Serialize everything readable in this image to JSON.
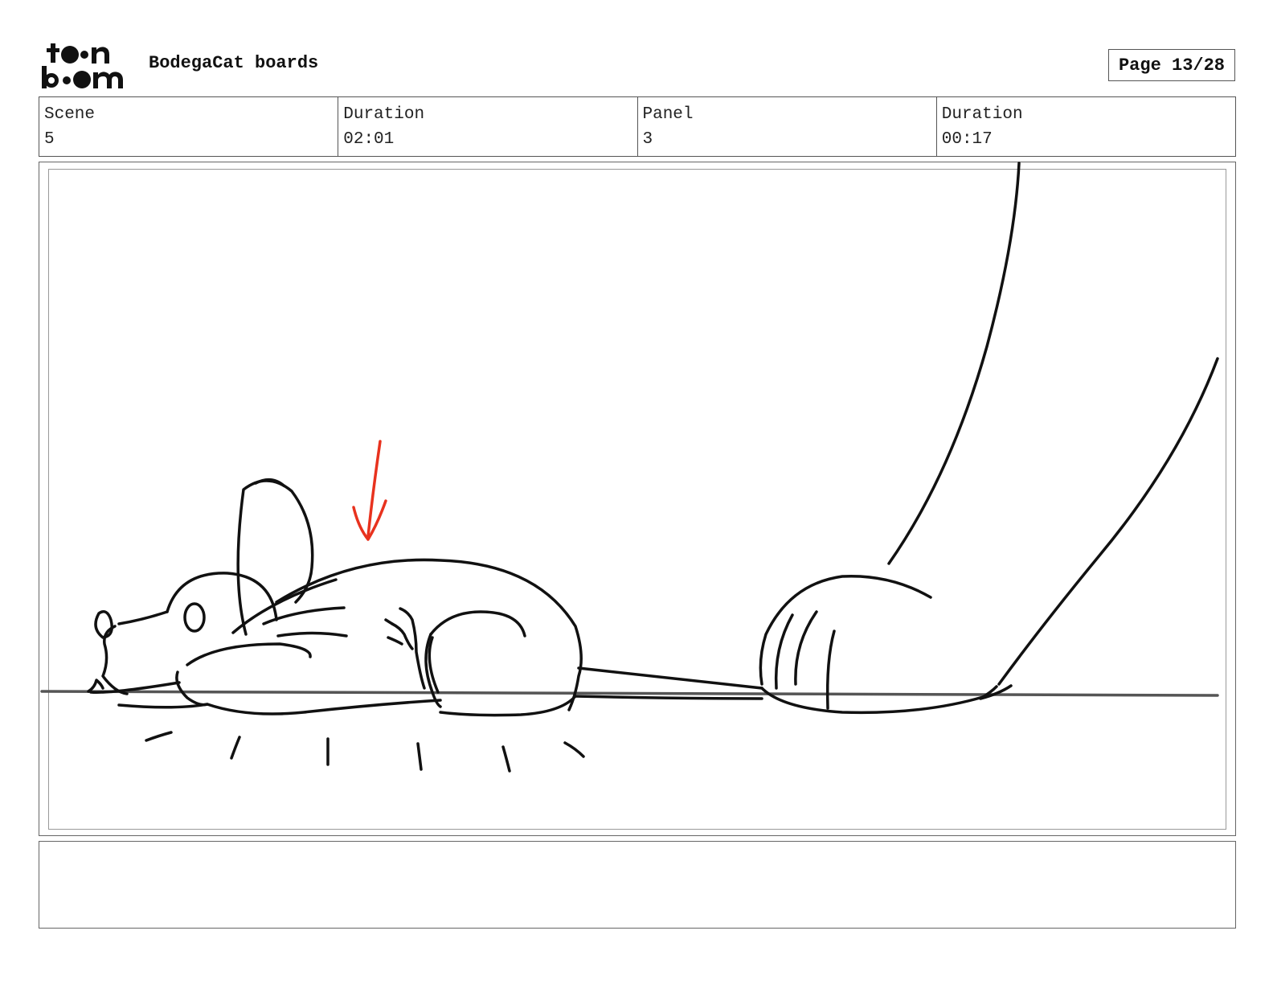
{
  "header": {
    "project_title": "BodegaCat boards",
    "page_label": "Page 13/28"
  },
  "info": {
    "scene_label": "Scene",
    "scene_value": "5",
    "scene_duration_label": "Duration",
    "scene_duration_value": "02:01",
    "panel_label": "Panel",
    "panel_value": "3",
    "panel_duration_label": "Duration",
    "panel_duration_value": "00:17"
  },
  "colors": {
    "ink": "#111111",
    "annotation_red": "#e8321e",
    "ground_line": "#555555"
  }
}
